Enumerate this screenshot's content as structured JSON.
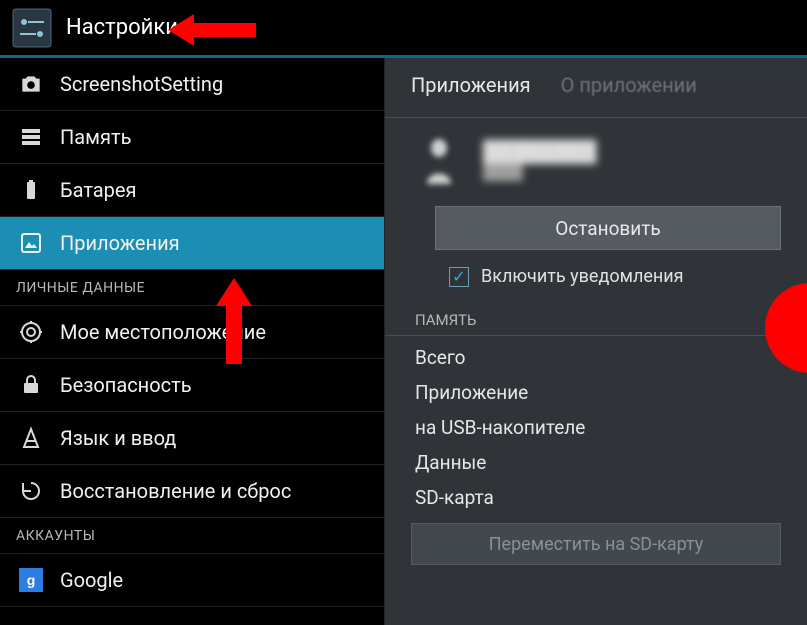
{
  "header": {
    "title": "Настройки"
  },
  "sidebar": {
    "items": [
      {
        "id": "screenshot",
        "label": "ScreenshotSetting",
        "icon": "camera-icon"
      },
      {
        "id": "memory",
        "label": "Память",
        "icon": "storage-icon"
      },
      {
        "id": "battery",
        "label": "Батарея",
        "icon": "battery-icon"
      },
      {
        "id": "apps",
        "label": "Приложения",
        "icon": "apps-icon",
        "selected": true
      }
    ],
    "section_personal": "ЛИЧНЫЕ ДАННЫЕ",
    "items2": [
      {
        "id": "location",
        "label": "Мое местоположение",
        "icon": "location-icon"
      },
      {
        "id": "security",
        "label": "Безопасность",
        "icon": "lock-icon"
      },
      {
        "id": "lang",
        "label": "Язык и ввод",
        "icon": "language-icon"
      },
      {
        "id": "reset",
        "label": "Восстановление и сброс",
        "icon": "reset-icon"
      }
    ],
    "section_accounts": "АККАУНТЫ",
    "items3": [
      {
        "id": "google",
        "label": "Google",
        "icon": "google-icon"
      }
    ]
  },
  "detail": {
    "tabs": {
      "active": "Приложения",
      "inactive": "О приложении"
    },
    "app": {
      "name": "████████",
      "sub": "████"
    },
    "stop_button": "Остановить",
    "notifications_label": "Включить уведомления",
    "notifications_checked": true,
    "memory_section": "ПАМЯТЬ",
    "memory_rows": [
      "Всего",
      "Приложение",
      "на USB-накопителе",
      "Данные",
      "SD-карта"
    ],
    "move_button": "Переместить на SD-карту"
  }
}
